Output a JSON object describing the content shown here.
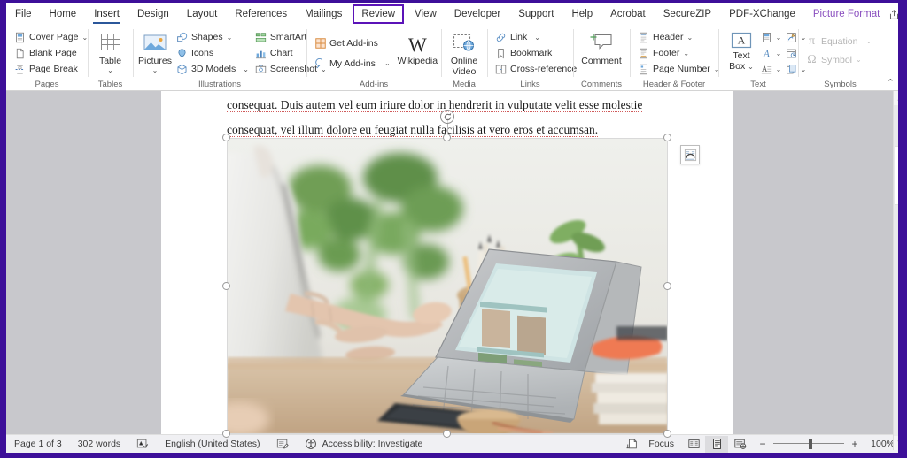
{
  "ribbon": {
    "tabs": [
      {
        "label": "File",
        "state": "normal"
      },
      {
        "label": "Home",
        "state": "normal"
      },
      {
        "label": "Insert",
        "state": "active"
      },
      {
        "label": "Design",
        "state": "normal"
      },
      {
        "label": "Layout",
        "state": "normal"
      },
      {
        "label": "References",
        "state": "normal"
      },
      {
        "label": "Mailings",
        "state": "normal"
      },
      {
        "label": "Review",
        "state": "highlighted"
      },
      {
        "label": "View",
        "state": "normal"
      },
      {
        "label": "Developer",
        "state": "normal"
      },
      {
        "label": "Support",
        "state": "normal"
      },
      {
        "label": "Help",
        "state": "normal"
      },
      {
        "label": "Acrobat",
        "state": "normal"
      },
      {
        "label": "SecureZIP",
        "state": "normal"
      },
      {
        "label": "PDF-XChange",
        "state": "normal"
      },
      {
        "label": "Picture Format",
        "state": "context"
      }
    ],
    "highlight_color": "#5b13b8",
    "accent_color": "#3d0f99",
    "groups": {
      "pages": {
        "label": "Pages",
        "items": [
          {
            "label": "Cover Page",
            "caret": "⌄",
            "icon": "cover-page-icon"
          },
          {
            "label": "Blank Page",
            "caret": "",
            "icon": "blank-page-icon"
          },
          {
            "label": "Page Break",
            "caret": "",
            "icon": "page-break-icon"
          }
        ]
      },
      "tables": {
        "label": "Tables",
        "button": {
          "label": "Table",
          "caret": "⌄",
          "icon": "table-icon"
        }
      },
      "illustrations": {
        "label": "Illustrations",
        "pictures": {
          "label": "Pictures",
          "caret": "⌄",
          "icon": "pictures-icon"
        },
        "items": [
          {
            "label": "Shapes",
            "caret": "⌄",
            "icon": "shapes-icon"
          },
          {
            "label": "Icons",
            "caret": "",
            "icon": "icons-icon"
          },
          {
            "label": "3D Models",
            "caret": "⌄",
            "icon": "3d-models-icon"
          },
          {
            "label": "SmartArt",
            "caret": "",
            "icon": "smartart-icon"
          },
          {
            "label": "Chart",
            "caret": "",
            "icon": "chart-icon"
          },
          {
            "label": "Screenshot",
            "caret": "⌄",
            "icon": "screenshot-icon"
          }
        ]
      },
      "addins": {
        "label": "Add-ins",
        "items": [
          {
            "label": "Get Add-ins",
            "caret": "",
            "icon": "get-addins-icon"
          },
          {
            "label": "My Add-ins",
            "caret": "⌄",
            "icon": "my-addins-icon"
          }
        ],
        "wikipedia": {
          "label": "Wikipedia",
          "icon": "wikipedia-icon",
          "glyph": "W"
        }
      },
      "media": {
        "label": "Media",
        "button": {
          "label_line1": "Online",
          "label_line2": "Video",
          "icon": "online-video-icon"
        }
      },
      "links": {
        "label": "Links",
        "items": [
          {
            "label": "Link",
            "caret": "⌄",
            "icon": "link-icon"
          },
          {
            "label": "Bookmark",
            "caret": "",
            "icon": "bookmark-icon"
          },
          {
            "label": "Cross-reference",
            "caret": "",
            "icon": "cross-reference-icon"
          }
        ]
      },
      "comments": {
        "label": "Comments",
        "button": {
          "label": "Comment",
          "icon": "comment-icon"
        }
      },
      "header_footer": {
        "label": "Header & Footer",
        "items": [
          {
            "label": "Header",
            "caret": "⌄",
            "icon": "header-icon"
          },
          {
            "label": "Footer",
            "caret": "⌄",
            "icon": "footer-icon"
          },
          {
            "label": "Page Number",
            "caret": "⌄",
            "icon": "page-number-icon"
          }
        ]
      },
      "text": {
        "label": "Text",
        "textbox": {
          "label_line1": "Text",
          "label_line2": "Box",
          "caret": "⌄",
          "icon": "text-box-icon",
          "glyph": "A"
        },
        "icons": [
          {
            "name": "quick-parts-icon",
            "caret": "⌄"
          },
          {
            "name": "signature-line-icon",
            "caret": "⌄"
          },
          {
            "name": "wordart-icon",
            "caret": "⌄"
          },
          {
            "name": "date-time-icon",
            "caret": ""
          },
          {
            "name": "drop-cap-icon",
            "caret": "⌄"
          },
          {
            "name": "object-icon",
            "caret": "⌄"
          }
        ]
      },
      "symbols": {
        "label": "Symbols",
        "items": [
          {
            "label": "Equation",
            "caret": "⌄",
            "icon": "equation-icon",
            "glyph": "π",
            "disabled": true
          },
          {
            "label": "Symbol",
            "caret": "⌄",
            "icon": "symbol-icon",
            "glyph": "Ω",
            "disabled": true
          }
        ]
      }
    },
    "collapse_label": "⌃",
    "share_icon": "share-icon",
    "comments_icon": "comments-icon"
  },
  "document": {
    "paragraph_line1": "consequat. Duis autem vel eum iriure dolor in hendrerit in vulputate velit esse molestie",
    "paragraph_line2": "consequat, vel illum dolore eu feugiat nulla facilisis at vero eros et accumsan.",
    "image": {
      "alt": "Person in white shirt working at a laptop on a desk with plants, pencil holder and books",
      "selected": true,
      "layout_options_icon": "layout-options-icon",
      "rotate_icon": "rotate-handle-icon"
    }
  },
  "statusbar": {
    "page": "Page 1 of 3",
    "words": "302 words",
    "proofing_icon": "proofing-errors-icon",
    "language": "English (United States)",
    "track_changes_icon": "track-changes-icon",
    "accessibility_icon": "accessibility-icon",
    "accessibility": "Accessibility: Investigate",
    "focus_icon": "focus-icon",
    "focus": "Focus",
    "views": [
      {
        "name": "read-mode-view",
        "selected": false
      },
      {
        "name": "print-layout-view",
        "selected": true
      },
      {
        "name": "web-layout-view",
        "selected": false
      }
    ],
    "zoom_out": "−",
    "zoom_in": "+",
    "zoom_level": "100%"
  }
}
